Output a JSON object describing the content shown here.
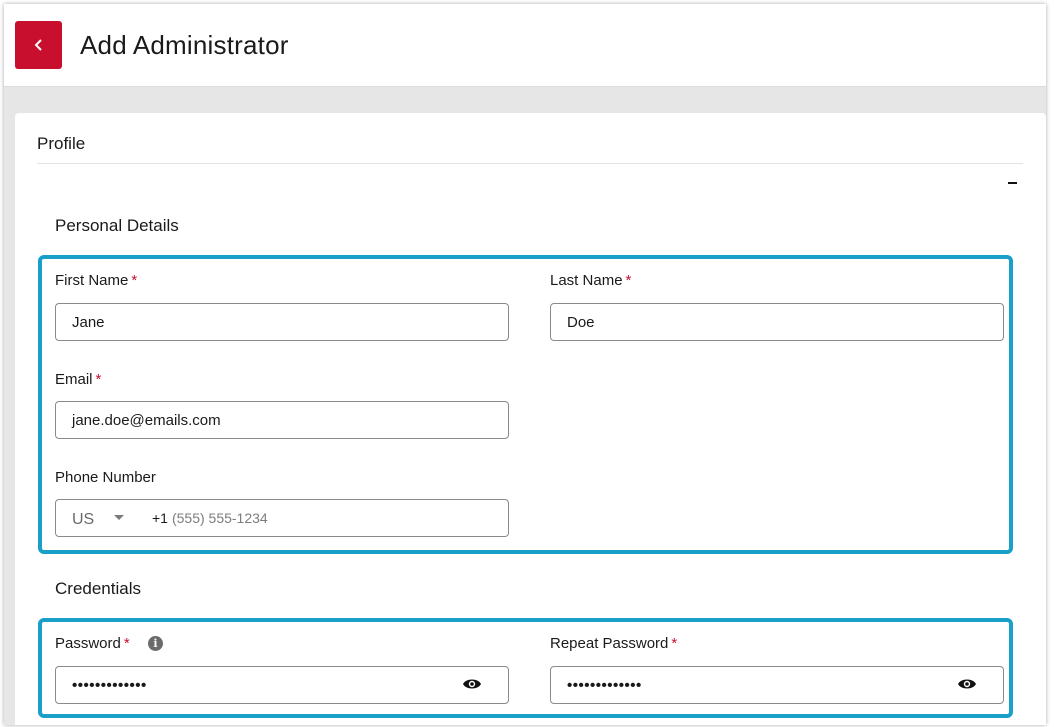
{
  "header": {
    "title": "Add Administrator",
    "back_icon": "chevron-left-icon"
  },
  "colors": {
    "accent": "#c8102e",
    "group_border": "#1aa0c8"
  },
  "profile": {
    "label": "Profile",
    "collapse_symbol": "−"
  },
  "personal_details": {
    "title": "Personal Details",
    "first_name": {
      "label": "First Name",
      "required": "*",
      "value": "Jane"
    },
    "last_name": {
      "label": "Last Name",
      "required": "*",
      "value": "Doe"
    },
    "email": {
      "label": "Email",
      "required": "*",
      "value": "jane.doe@emails.com"
    },
    "phone": {
      "label": "Phone Number",
      "country": "US",
      "dial_code": "+1",
      "placeholder": "(555) 555-1234"
    }
  },
  "credentials": {
    "title": "Credentials",
    "password": {
      "label": "Password",
      "required": "*",
      "info_symbol": "i",
      "masked_value": "•••••••••••••"
    },
    "repeat_password": {
      "label": "Repeat Password",
      "required": "*",
      "masked_value": "•••••••••••••"
    }
  }
}
